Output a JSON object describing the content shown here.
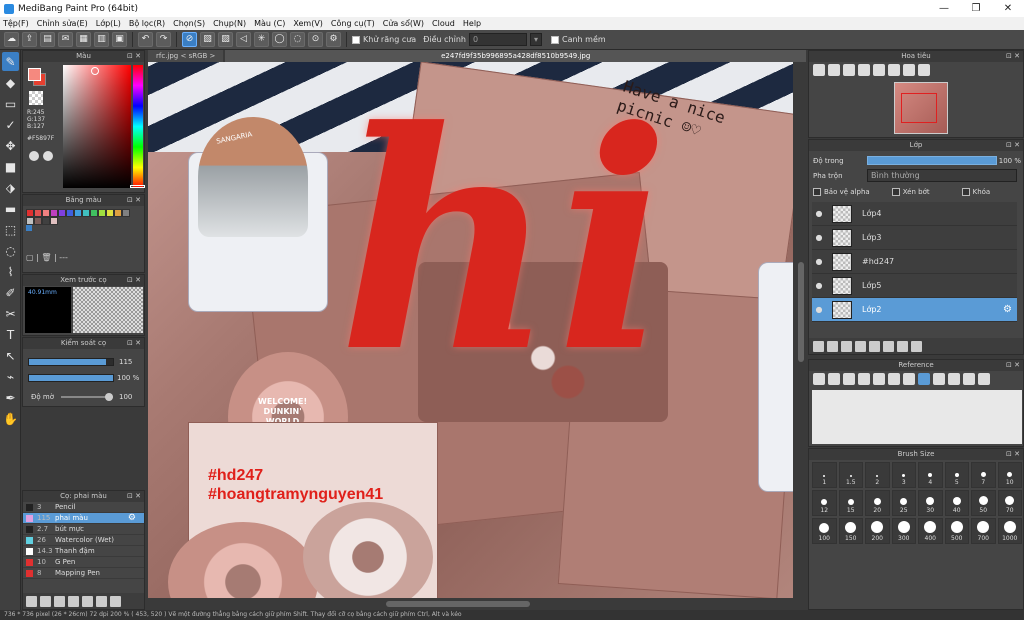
{
  "window": {
    "title": "MediBang Paint Pro (64bit)",
    "min": "—",
    "max": "❐",
    "close": "✕"
  },
  "menu": [
    "Tệp(F)",
    "Chỉnh sửa(E)",
    "Lớp(L)",
    "Bộ lọc(R)",
    "Chọn(S)",
    "Chụp(N)",
    "Màu (C)",
    "Xem(V)",
    "Công cụ(T)",
    "Cửa sổ(W)",
    "Cloud",
    "Help"
  ],
  "toolbar": {
    "antialias_label": "Khử răng cưa",
    "adjust_label": "Điều chỉnh",
    "adjust_value": "0",
    "smooth_label": "Canh mềm"
  },
  "tabs": [
    "rfc.jpg < sRGB >",
    "e247fd9f35b996895a428df8510b9549.jpg"
  ],
  "color_panel": {
    "title": "Màu",
    "r": "R:245",
    "g": "G:137",
    "b": "B:127",
    "hex": "#F5897F",
    "fg": "#f5897f",
    "bg": "#e64030"
  },
  "palette_panel": {
    "title": "Bảng màu",
    "footer": "---",
    "swatches": [
      "#e03030",
      "#e05050",
      "#f08080",
      "#c040c0",
      "#8040e0",
      "#4060e0",
      "#40a0e0",
      "#40c0c0",
      "#40c060",
      "#a0e040",
      "#e0e040",
      "#e0a040",
      "#808080",
      "#c0c0c0",
      "#7a5c58",
      "#404040",
      "#e0c0c0"
    ]
  },
  "preview_panel": {
    "title": "Xem trước cọ",
    "size": "40.91mm"
  },
  "brush_control": {
    "title": "Kiểm soát cọ",
    "size_value": "115",
    "size_fill": 0.92,
    "opacity_value": "100 %",
    "opacity_fill": 1.0,
    "blur_label": "Độ mờ",
    "blur_value": "100"
  },
  "brush_list": {
    "title": "Cọ: phai màu",
    "items": [
      {
        "num": "3",
        "name": "Pencil",
        "color": "#222222"
      },
      {
        "num": "115",
        "name": "phai màu",
        "color": "#e0a0e0",
        "selected": true
      },
      {
        "num": "2.7",
        "name": "bút mực",
        "color": "#222222"
      },
      {
        "num": "26",
        "name": "Watercolor (Wet)",
        "color": "#60d0e0"
      },
      {
        "num": "14.3",
        "name": "Thanh đậm",
        "color": "#ffffff"
      },
      {
        "num": "10",
        "name": "G Pen",
        "color": "#e03030"
      },
      {
        "num": "8",
        "name": "Mapping Pen",
        "color": "#e03030"
      }
    ]
  },
  "navigator": {
    "title": "Hoa tiêu"
  },
  "layer_panel": {
    "title": "Lớp",
    "opacity_label": "Độ trong",
    "opacity_value": "100 %",
    "opacity_fill": 1.0,
    "blend_label": "Pha trộn",
    "blend_value": "Bình thường",
    "protect_alpha": "Bảo vệ alpha",
    "clipping": "Xén bớt",
    "lock": "Khóa",
    "layers": [
      {
        "name": "Lớp4",
        "selected": false
      },
      {
        "name": "Lớp3",
        "selected": false
      },
      {
        "name": "#hd247",
        "selected": false
      },
      {
        "name": "Lớp5",
        "selected": false
      },
      {
        "name": "Lớp2",
        "selected": true
      }
    ]
  },
  "reference_panel": {
    "title": "Reference"
  },
  "brush_size_panel": {
    "title": "Brush Size",
    "sizes": [
      "1",
      "1.5",
      "2",
      "3",
      "4",
      "5",
      "7",
      "10",
      "12",
      "15",
      "20",
      "25",
      "30",
      "40",
      "50",
      "70",
      "100",
      "150",
      "200",
      "300",
      "400",
      "500",
      "700",
      "1000"
    ]
  },
  "canvas": {
    "hi_text": "hi",
    "hashtag1": "#hd247",
    "hashtag2": "#hoangtramynguyen41",
    "note_line1": "Have a nice",
    "note_line2": "picnic ☺♡",
    "donut_label1": "WELCOME!",
    "donut_label2": "DUNKIN'",
    "donut_label3": "WORLD",
    "can_label": "SANGARIA"
  },
  "status": "736 * 736 pixel  (26 * 26cm)  72 dpi  200 %  ( 453, 520 )  Vẽ một đường thẳng bằng cách giữ phím Shift. Thay đổi cỡ cọ bằng cách giữ phím Ctrl, Alt và kéo"
}
